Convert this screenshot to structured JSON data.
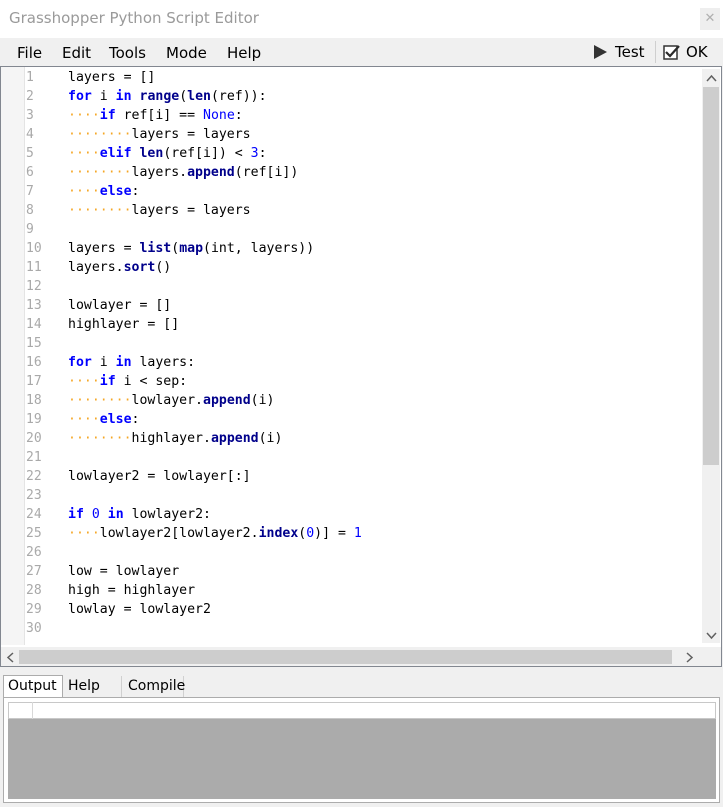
{
  "window": {
    "title": "Grasshopper Python Script Editor",
    "close_label": "✕"
  },
  "menu": {
    "items": [
      "File",
      "Edit",
      "Tools",
      "Mode",
      "Help"
    ]
  },
  "toolbar": {
    "test_label": "Test",
    "ok_label": "OK"
  },
  "editor": {
    "lines": [
      "layers = []",
      "for i in range(len(ref)):",
      "····if ref[i] == None:",
      "········layers = layers",
      "····elif len(ref[i]) < 3:",
      "········layers.append(ref[i])",
      "····else:",
      "········layers = layers",
      "",
      "layers = list(map(int, layers))",
      "layers.sort()",
      "",
      "lowlayer = []",
      "highlayer = []",
      "",
      "for i in layers:",
      "····if i < sep:",
      "········lowlayer.append(i)",
      "····else:",
      "········highlayer.append(i)",
      "",
      "lowlayer2 = lowlayer[:]",
      "",
      "if 0 in lowlayer2:",
      "····lowlayer2[lowlayer2.index(0)] = 1",
      "",
      "low = lowlayer",
      "high = highlayer",
      "lowlay = lowlayer2",
      "",
      ""
    ]
  },
  "bottom": {
    "tabs": [
      "Output",
      "Help",
      "Compile"
    ],
    "active_tab": "Output"
  },
  "colors": {
    "keyword": "#0000ff",
    "builtin": "#00008b",
    "indent_dots": "#f5a623",
    "line_numbers": "#a9a9a9"
  }
}
